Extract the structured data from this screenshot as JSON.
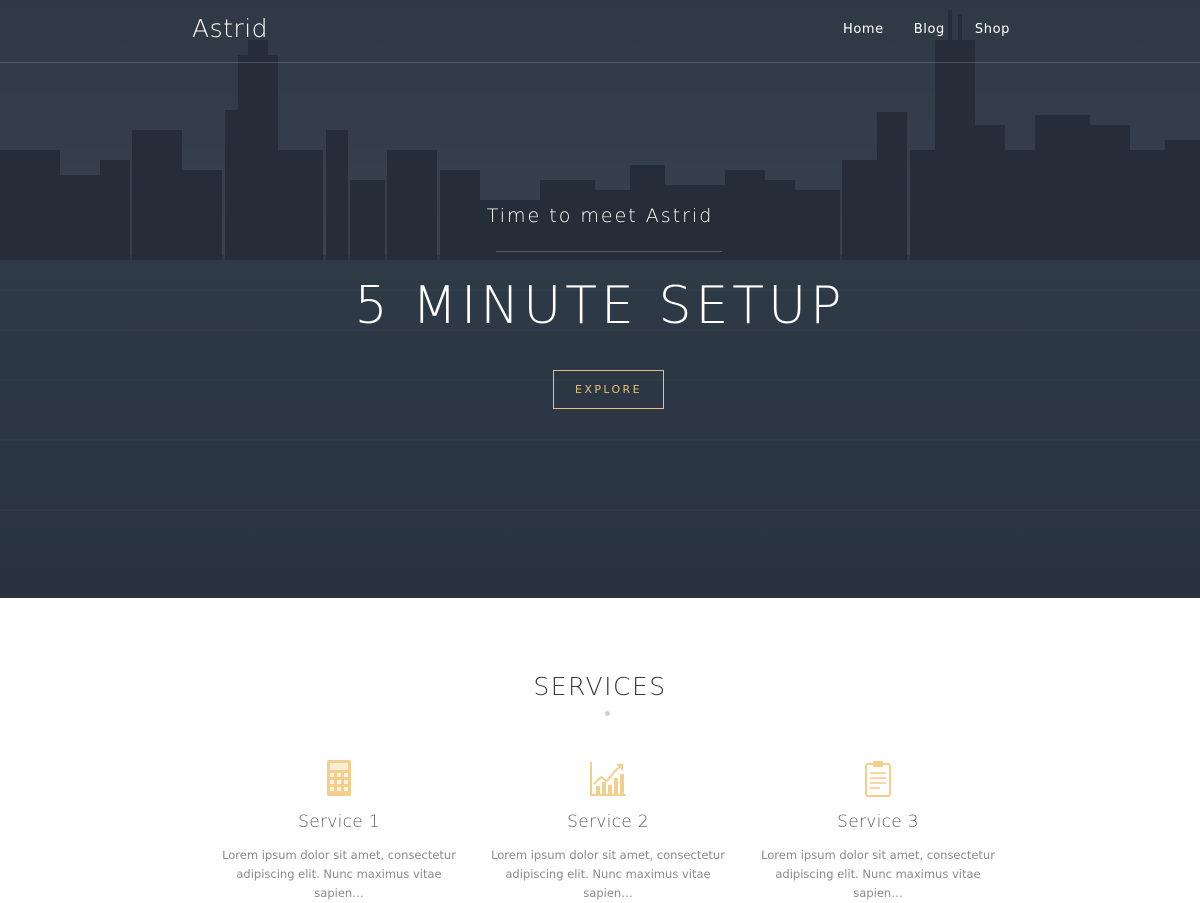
{
  "header": {
    "brand": "Astrid",
    "nav": [
      {
        "label": "Home"
      },
      {
        "label": "Blog"
      },
      {
        "label": "Shop"
      }
    ]
  },
  "hero": {
    "subtitle": "Time to meet Astrid",
    "title": "5 MINUTE SETUP",
    "cta_label": "EXPLORE"
  },
  "services": {
    "title": "SERVICES",
    "items": [
      {
        "icon": "calculator-icon",
        "name": "Service 1",
        "description": "Lorem ipsum dolor sit amet, consectetur adipiscing elit. Nunc maximus vitae sapien…"
      },
      {
        "icon": "chart-growth-icon",
        "name": "Service 2",
        "description": "Lorem ipsum dolor sit amet, consectetur adipiscing elit. Nunc maximus vitae sapien…"
      },
      {
        "icon": "clipboard-icon",
        "name": "Service 3",
        "description": "Lorem ipsum dolor sit amet, consectetur adipiscing elit. Nunc maximus vitae sapien…"
      }
    ]
  },
  "colors": {
    "accent": "#e8c07a",
    "hero_overlay": "#2a3340"
  }
}
